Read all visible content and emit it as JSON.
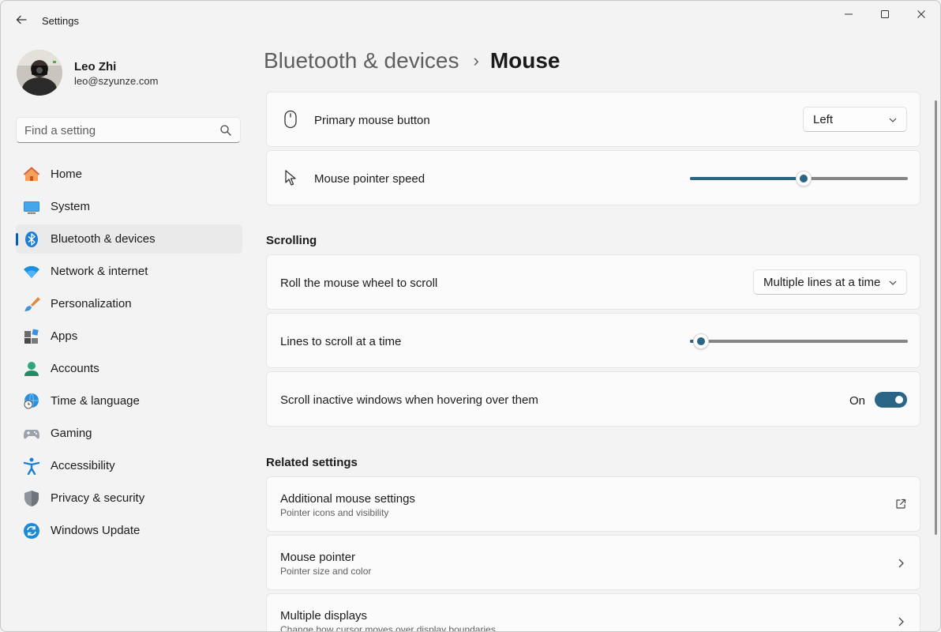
{
  "window": {
    "title": "Settings"
  },
  "profile": {
    "name": "Leo Zhi",
    "email": "leo@szyunze.com"
  },
  "search": {
    "placeholder": "Find a setting"
  },
  "nav": {
    "items": [
      {
        "label": "Home",
        "icon": "home-icon"
      },
      {
        "label": "System",
        "icon": "system-icon"
      },
      {
        "label": "Bluetooth & devices",
        "icon": "bluetooth-icon",
        "selected": true
      },
      {
        "label": "Network & internet",
        "icon": "wifi-icon"
      },
      {
        "label": "Personalization",
        "icon": "brush-icon"
      },
      {
        "label": "Apps",
        "icon": "apps-icon"
      },
      {
        "label": "Accounts",
        "icon": "account-icon"
      },
      {
        "label": "Time & language",
        "icon": "globe-clock-icon"
      },
      {
        "label": "Gaming",
        "icon": "gamepad-icon"
      },
      {
        "label": "Accessibility",
        "icon": "accessibility-icon"
      },
      {
        "label": "Privacy & security",
        "icon": "shield-icon"
      },
      {
        "label": "Windows Update",
        "icon": "update-icon"
      }
    ]
  },
  "breadcrumb": {
    "parent": "Bluetooth & devices",
    "separator": "›",
    "current": "Mouse"
  },
  "mouse": {
    "primary_button_label": "Primary mouse button",
    "primary_button_value": "Left",
    "pointer_speed_label": "Mouse pointer speed",
    "pointer_speed_fraction": 0.52
  },
  "scrolling": {
    "title": "Scrolling",
    "roll_label": "Roll the mouse wheel to scroll",
    "roll_value": "Multiple lines at a time",
    "lines_label": "Lines to scroll at a time",
    "lines_fraction": 0.05,
    "inactive_label": "Scroll inactive windows when hovering over them",
    "inactive_state": "On"
  },
  "related": {
    "title": "Related settings",
    "items": [
      {
        "label": "Additional mouse settings",
        "sub": "Pointer icons and visibility",
        "icon": "external-link-icon"
      },
      {
        "label": "Mouse pointer",
        "sub": "Pointer size and color",
        "icon": "chevron-right-icon"
      },
      {
        "label": "Multiple displays",
        "sub": "Change how cursor moves over display boundaries",
        "icon": "chevron-right-icon"
      }
    ]
  },
  "colors": {
    "accent": "#2b6585",
    "selection_bar": "#005fb8",
    "background": "#f3f3f3",
    "card": "#fbfbfb"
  }
}
